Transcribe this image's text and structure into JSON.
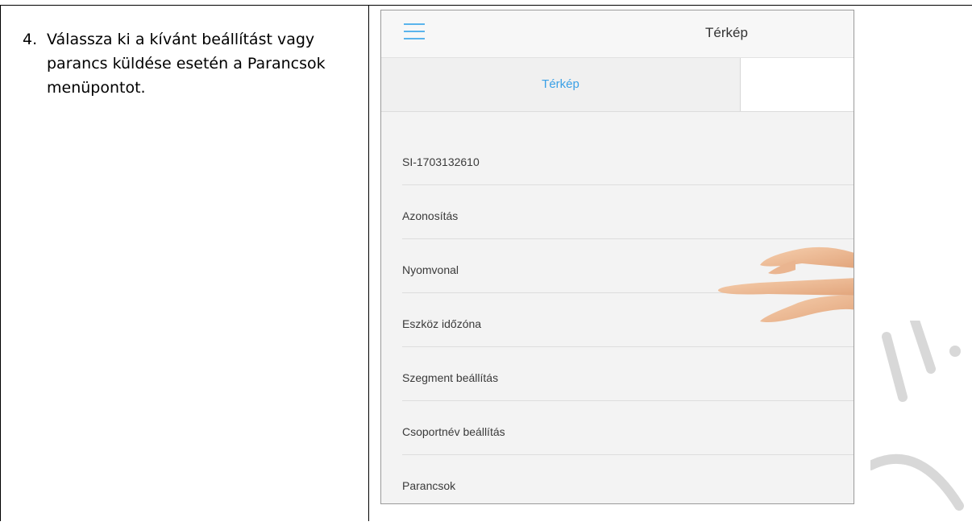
{
  "step": {
    "number": "4.",
    "text": "Válassza ki a kívánt beállítást vagy parancs küldése esetén a Parancsok menüpontot."
  },
  "app": {
    "header_title": "Térkép",
    "tabs": [
      {
        "label": "Térkép",
        "active": true
      },
      {
        "label": "",
        "active": false
      }
    ],
    "menu_items": [
      {
        "label": "SI-1703132610"
      },
      {
        "label": "Azonosítás"
      },
      {
        "label": "Nyomvonal"
      },
      {
        "label": "Eszköz időzóna"
      },
      {
        "label": "Szegment beállítás"
      },
      {
        "label": "Csoportnév beállítás"
      },
      {
        "label": "Parancsok"
      }
    ]
  },
  "icons": {
    "menu": "hamburger-menu-icon",
    "pointer": "pointing-hand-icon"
  },
  "colors": {
    "accent": "#3aa0e6",
    "hamburger": "#5ab4ec"
  }
}
